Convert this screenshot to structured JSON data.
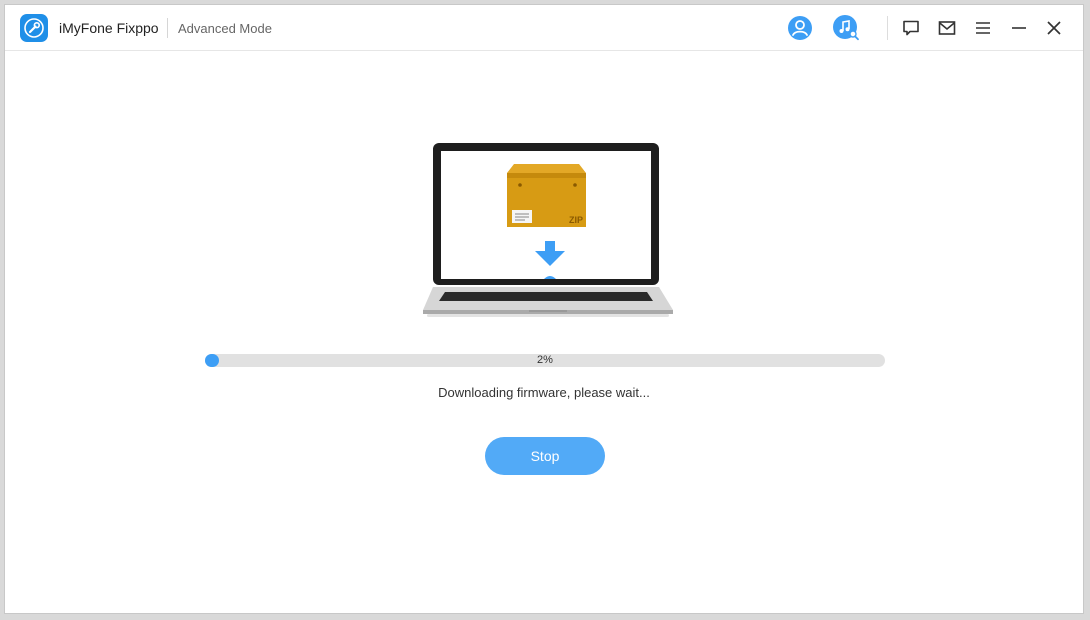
{
  "app": {
    "name": "iMyFone Fixppo",
    "mode": "Advanced Mode",
    "logo_icon": "wrench-icon"
  },
  "toolbar": {
    "icons": [
      "account-icon",
      "music-search-icon",
      "feedback-icon",
      "mail-icon",
      "menu-icon",
      "minimize-icon",
      "close-icon"
    ]
  },
  "illustration": {
    "box_label": "ZIP"
  },
  "progress": {
    "percent": 2,
    "label": "2%"
  },
  "status": {
    "message": "Downloading firmware, please wait..."
  },
  "actions": {
    "stop_label": "Stop"
  },
  "colors": {
    "accent": "#3d9ef5",
    "button": "#52aaf7",
    "brand": "#1f8fe8"
  }
}
